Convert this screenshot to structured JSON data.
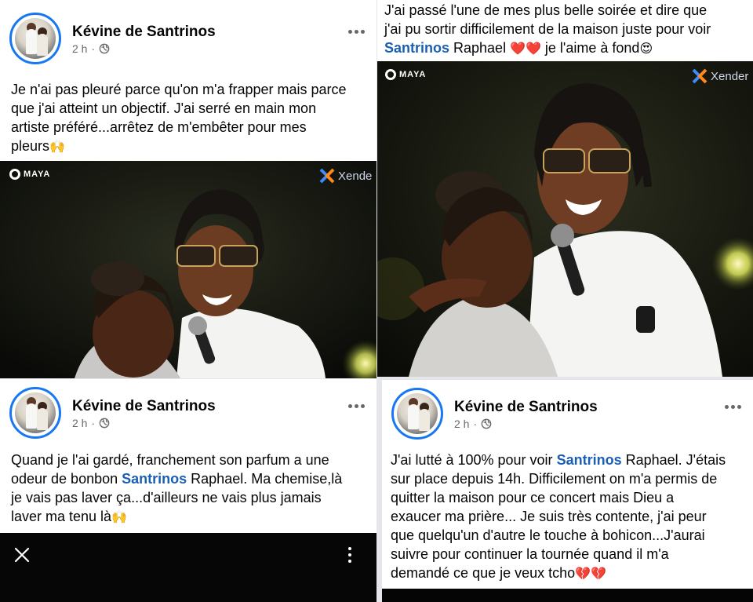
{
  "posts": {
    "top_left": {
      "author": "Kévine de Santrinos",
      "time": "2 h",
      "dot": "·",
      "text_line1": "Je n'ai pas pleuré parce qu'on m'a frapper mais parce",
      "text_line2": "que j'ai atteint un objectif. J'ai serré en main mon",
      "text_line3": "artiste préféré...arrêtez de m'embêter pour mes",
      "text_line4": "pleurs",
      "emoji_end": "🙌"
    },
    "top_right": {
      "text_line1": "J'ai passé l'une de mes plus belle soirée et dire que",
      "text_line2": "j'ai pu sortir difficilement de la maison juste pour voir",
      "mention": "Santrinos",
      "text_line3_after_mention": " Raphael ",
      "hearts": "❤️❤️",
      "text_line3_tail": " je l'aime à fond",
      "emoji_end": "😍"
    },
    "bottom_left": {
      "author": "Kévine de Santrinos",
      "time": "2 h",
      "dot": "·",
      "text_line1": "Quand je l'ai gardé, franchement son parfum a une",
      "text_line2_before": "odeur de bonbon ",
      "mention": "Santrinos",
      "text_line2_after": " Raphael. Ma chemise,là",
      "text_line3": "je vais pas laver ça...d'ailleurs ne vais plus jamais",
      "text_line4": "laver ma tenu là",
      "emoji_end": "🙌"
    },
    "bottom_right": {
      "author": "Kévine de Santrinos",
      "time": "2 h",
      "dot": "·",
      "text_line1_before": "J'ai lutté à 100% pour voir ",
      "mention": "Santrinos",
      "text_line1_after": " Raphael. J'étais",
      "text_line2": "sur place depuis 14h. Difficilement on m'a permis de",
      "text_line3": "quitter la maison pour ce concert mais Dieu a",
      "text_line4": "exaucer ma prière... Je suis très contente, j'ai peur",
      "text_line5": "que quelqu'un d'autre le touche à bohicon...J'aurai",
      "text_line6": "suivre pour continuer la tournée quand il m'a",
      "text_line7": "demandé ce que je veux tcho",
      "emoji_end": "💔💔"
    }
  },
  "watermarks": {
    "maya": "MAYA",
    "xender": "Xende",
    "xender_right": "Xender"
  },
  "icons": {
    "more": "more-horizontal-icon",
    "privacy": "globe-icon",
    "close": "close-icon",
    "menu": "more-vertical-icon"
  },
  "colors": {
    "mention": "#1a5fb4",
    "avatar_ring": "#1877f2",
    "meta": "#65676b"
  }
}
